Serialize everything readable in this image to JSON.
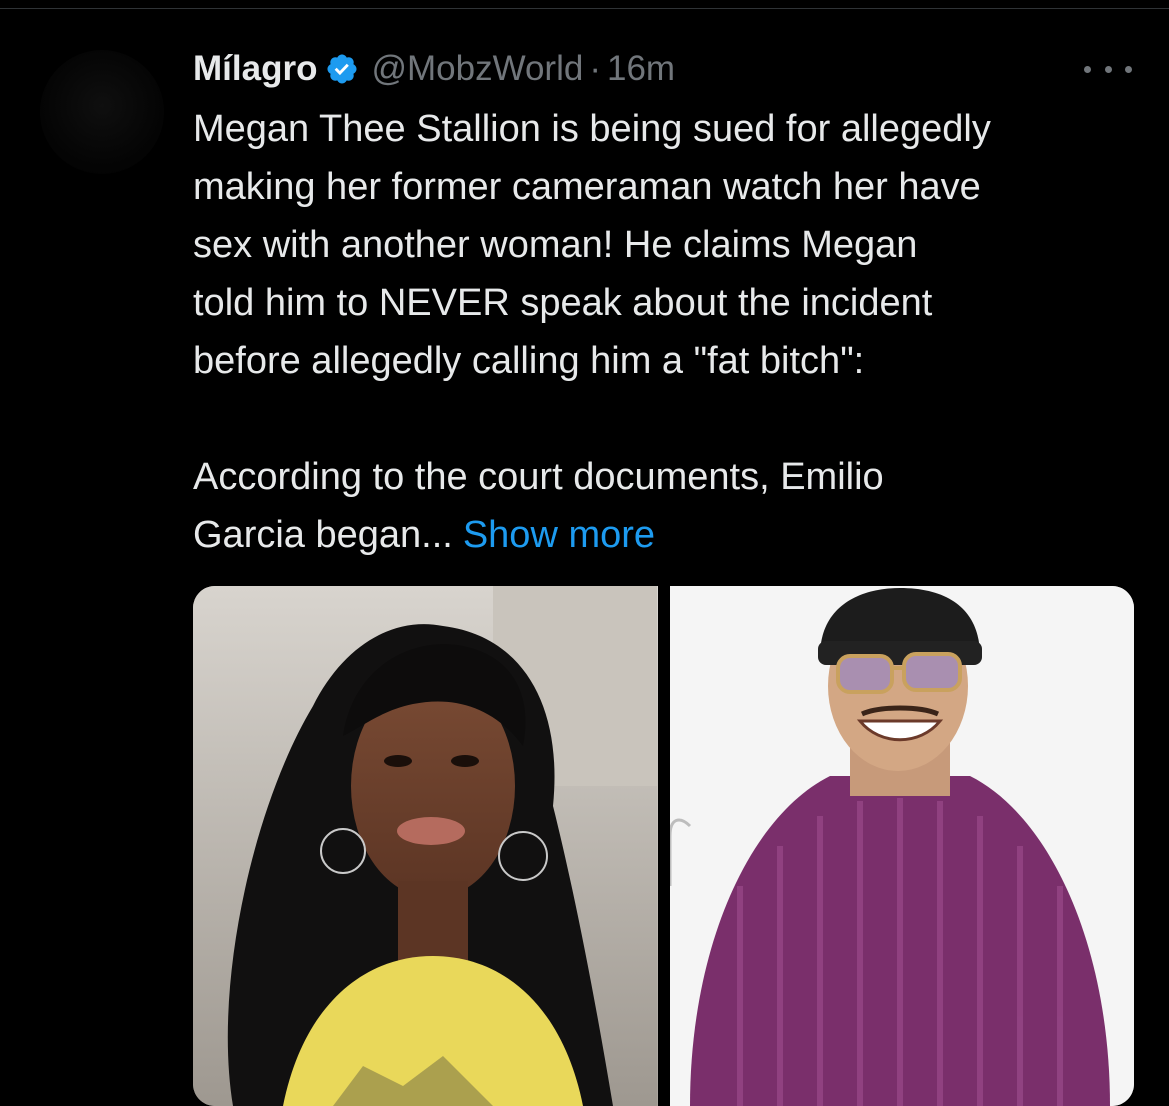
{
  "tweet": {
    "display_name": "Mílagro",
    "handle": "@MobzWorld",
    "separator": "·",
    "time": "16m",
    "text_lines": [
      "Megan Thee Stallion is being sued for allegedly",
      "making her former cameraman watch her have",
      "sex with another woman! He claims Megan",
      "told him to NEVER speak about the incident",
      "before allegedly calling him a \"fat bitch\":"
    ],
    "text_lines_2": [
      "According to the court documents, Emilio",
      "Garcia began..."
    ],
    "show_more_label": "Show more"
  },
  "icons": {
    "verified": "verified-badge-icon",
    "more": "more-options-icon"
  },
  "colors": {
    "background": "#000000",
    "text": "#e7e9ea",
    "secondary": "#71767b",
    "link": "#1d9bf0",
    "badge": "#1d9bf0"
  },
  "media": [
    {
      "kind": "photo",
      "subject": "woman with long black hair and bangs, hoop earrings, yellow top"
    },
    {
      "kind": "photo",
      "subject": "man in black beanie, tinted glasses, purple knit sweater"
    }
  ]
}
